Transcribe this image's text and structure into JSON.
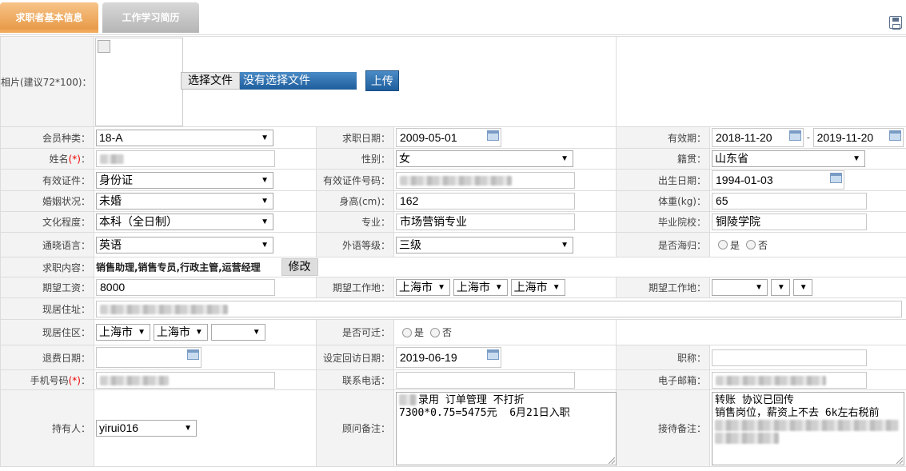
{
  "tabs": {
    "basic": "求职者基本信息",
    "experience": "工作学习简历"
  },
  "icons": {
    "save": "save-icon",
    "calendar": "calendar-icon"
  },
  "photo": {
    "label": "相片(建议72*100)：",
    "choose_file": "选择文件",
    "no_file": "没有选择文件",
    "upload": "上传"
  },
  "member_type": {
    "label": "会员种类：",
    "value": "18-A"
  },
  "job_date": {
    "label": "求职日期：",
    "value": "2009-05-01"
  },
  "valid_period": {
    "label": "有效期：",
    "from": "2018-11-20",
    "sep": "-",
    "to": "2019-11-20"
  },
  "name": {
    "label": "姓名",
    "req": "(*)",
    "colon": "："
  },
  "gender": {
    "label": "性别：",
    "value": "女"
  },
  "native_place": {
    "label": "籍贯：",
    "value": "山东省"
  },
  "id_type": {
    "label": "有效证件：",
    "value": "身份证"
  },
  "id_number": {
    "label": "有效证件号码："
  },
  "birth_date": {
    "label": "出生日期：",
    "value": "1994-01-03"
  },
  "marital": {
    "label": "婚姻状况：",
    "value": "未婚"
  },
  "height": {
    "label": "身高(cm)：",
    "value": "162"
  },
  "weight": {
    "label": "体重(kg)：",
    "value": "65"
  },
  "education": {
    "label": "文化程度：",
    "value": "本科（全日制）"
  },
  "major": {
    "label": "专业：",
    "value": "市场营销专业"
  },
  "school": {
    "label": "毕业院校：",
    "value": "铜陵学院"
  },
  "language": {
    "label": "通晓语言：",
    "value": "英语"
  },
  "foreign_level": {
    "label": "外语等级：",
    "value": "三级"
  },
  "returnee": {
    "label": "是否海归：",
    "yes": "是",
    "no": "否"
  },
  "job_content": {
    "label": "求职内容：",
    "value": "销售助理,销售专员,行政主管,运营经理",
    "edit": "修改"
  },
  "salary": {
    "label": "期望工资：",
    "value": "8000"
  },
  "work_place1": {
    "label": "期望工作地：",
    "province": "上海市",
    "city": "上海市",
    "district": "上海市"
  },
  "work_place2": {
    "label": "期望工作地："
  },
  "address": {
    "label": "现居住址："
  },
  "living_area": {
    "label": "现居住区：",
    "province": "上海市",
    "city": "上海市"
  },
  "relocate": {
    "label": "是否可迁：",
    "yes": "是",
    "no": "否"
  },
  "refund_date": {
    "label": "退费日期："
  },
  "callback_date": {
    "label": "设定回访日期：",
    "value": "2019-06-19"
  },
  "title": {
    "label": "职称："
  },
  "mobile": {
    "label": "手机号码",
    "req": "(*)",
    "colon": "："
  },
  "phone": {
    "label": "联系电话："
  },
  "email": {
    "label": "电子邮箱："
  },
  "holder": {
    "label": "持有人：",
    "value": "yirui016"
  },
  "consultant_note": {
    "label": "顾问备注：",
    "line1": "录用 订单管理 不打折",
    "line2": "7300*0.75=5475元  6月21日入职"
  },
  "reception_note": {
    "label": "接待备注：",
    "line1": "转账 协议已回传",
    "line2": "销售岗位，薪资上不去 6k左右税前"
  }
}
